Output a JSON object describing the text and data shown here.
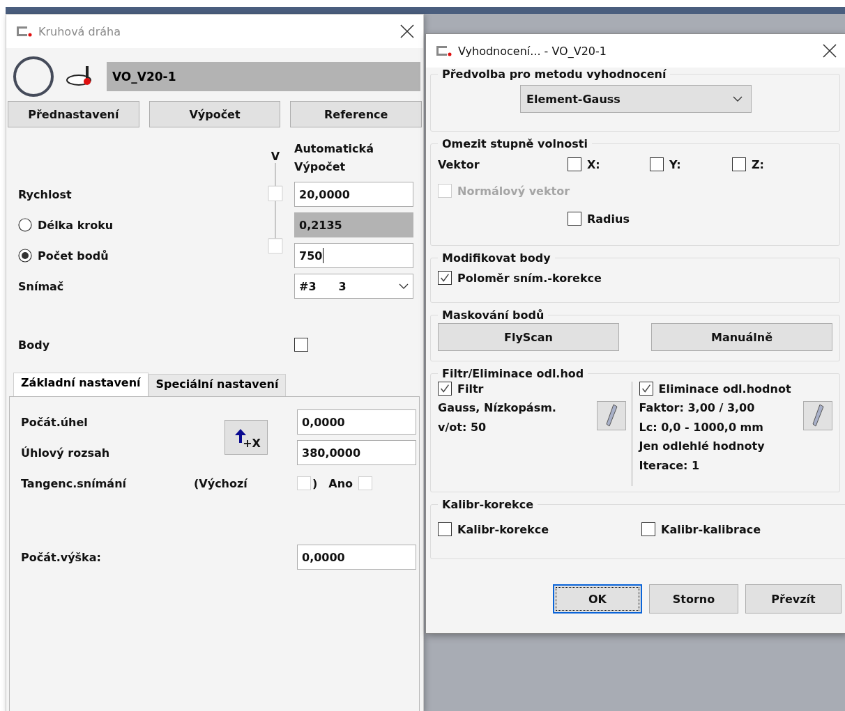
{
  "left_window": {
    "title": "Kruhová dráha",
    "name_field": "VO_V20-1",
    "buttons": [
      "Přednastavení",
      "Výpočet",
      "Reference"
    ],
    "column_headers": [
      "Automatická",
      "Výpočet"
    ],
    "link_header": "V",
    "rows": [
      {
        "kind": "field",
        "label": "Rychlost",
        "value": "20,0000",
        "disabled": false
      },
      {
        "kind": "radio",
        "label": "Délka kroku",
        "selected": false,
        "value": "0,2135",
        "disabled": true
      },
      {
        "kind": "radio",
        "label": "Počet bodů",
        "selected": true,
        "value": "750",
        "disabled": false
      },
      {
        "kind": "combo",
        "label": "Snímač",
        "value": "#3",
        "value_2": "3"
      },
      {
        "kind": "checkbox",
        "label": "Body",
        "checked": false
      }
    ],
    "tabs": [
      {
        "label": "Základní nastavení",
        "selected": true
      },
      {
        "label": "Speciální nastavení",
        "selected": false
      }
    ],
    "start_angle": {
      "label": "Počát.úhel",
      "value": "0,0000"
    },
    "angle_range": {
      "label": "Úhlový rozsah",
      "value": "380,0000"
    },
    "direction_button": "+X",
    "tangential": {
      "label": "Tangenc.snímání",
      "default_label": "(Výchozí",
      "default_checked": false,
      "bracket": ")",
      "yes_label": "Ano",
      "yes_checked": false
    },
    "start_height": {
      "label": "Počát.výška:",
      "value": "0,0000"
    }
  },
  "eval_dialog": {
    "title": "Vyhodnocení... - VO_V20-1",
    "groups": [
      {
        "kind": "preset",
        "title": "Předvolba pro metodu vyhodnocení",
        "value": "Element-Gauss"
      },
      {
        "kind": "dof",
        "title": "Omezit stupně volnosti",
        "vector_label": "Vektor",
        "axes": [
          {
            "label": "X:",
            "checked": false
          },
          {
            "label": "Y:",
            "checked": false
          },
          {
            "label": "Z:",
            "checked": false
          }
        ],
        "normal": {
          "label": "Normálový vektor",
          "checked": false,
          "disabled": true
        },
        "radius": {
          "label": "Radius",
          "checked": false
        }
      },
      {
        "kind": "options",
        "title": "Modifikovat body",
        "options": [
          {
            "label": "Poloměr sním.-korekce",
            "checked": true
          }
        ]
      },
      {
        "kind": "buttons",
        "title": "Maskování bodů",
        "buttons": [
          "FlyScan",
          "Manuálně"
        ]
      },
      {
        "kind": "filter",
        "title": "Filtr/Eliminace odl.hod",
        "columns": [
          {
            "label": "Filtr",
            "checked": true,
            "lines": [
              "Gauss, Nízkopásm.",
              "v/ot: 50"
            ]
          },
          {
            "label": "Eliminace odl.hodnot",
            "checked": true,
            "lines": [
              "Faktor: 3,00 / 3,00",
              "Lc: 0,0 - 1000,0 mm",
              "Jen odlehlé hodnoty",
              "Iterace: 1"
            ]
          }
        ]
      },
      {
        "kind": "options",
        "title": "Kalibr-korekce",
        "options": [
          {
            "label": "Kalibr-korekce",
            "checked": false
          },
          {
            "label": "Kalibr-kalibrace",
            "checked": false
          }
        ]
      }
    ],
    "buttons": [
      {
        "label": "OK",
        "default": true
      },
      {
        "label": "Storno",
        "default": false
      },
      {
        "label": "Převzít",
        "default": false
      }
    ]
  }
}
